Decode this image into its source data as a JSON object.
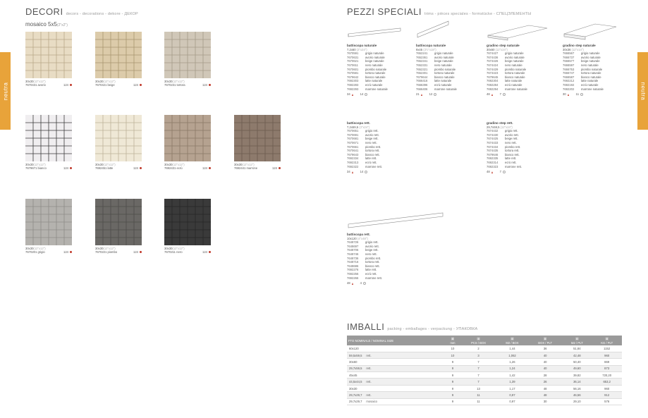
{
  "side_tab": {
    "left": "neutra",
    "right": "neutra"
  },
  "decori": {
    "title": "DECORI",
    "subtitle": "decors - decorations - dekore - ДЕКОР",
    "mosaico_title": "mosaico 5x5",
    "mosaico_dim": "(2\"x2\")",
    "tiles": [
      {
        "size": "30x30",
        "unit": "(12\"x12\")",
        "code": "7670431",
        "color": "avorio",
        "qty": "124",
        "bg": "#e8dcc4",
        "line": "#b8a888"
      },
      {
        "size": "30x30",
        "unit": "(12\"x12\")",
        "code": "7670421",
        "color": "beige",
        "qty": "124",
        "bg": "#dccbaa",
        "line": "#a8956f"
      },
      {
        "size": "30x30",
        "unit": "(12\"x12\")",
        "code": "7670231",
        "color": "tortora",
        "qty": "124",
        "bg": "#d0c7b8",
        "line": "#a49a88"
      },
      {
        "size": "30x30",
        "unit": "(12\"x12\")",
        "code": "7679671",
        "color": "bianco",
        "qty": "124",
        "bg": "#f0eef0",
        "line": "#3a3a3a"
      },
      {
        "size": "30x30",
        "unit": "(12\"x12\")",
        "code": "7692451",
        "color": "latte",
        "qty": "124",
        "bg": "#efe8d6",
        "line": "#bdb298"
      },
      {
        "size": "30x30",
        "unit": "(12\"x12\")",
        "code": "7692431",
        "color": "ecrù",
        "qty": "124",
        "bg": "#b5a290",
        "line": "#8a7866"
      },
      {
        "size": "30x30",
        "unit": "(12\"x12\")",
        "code": "7692441",
        "color": "marrone",
        "qty": "124",
        "bg": "#8d7a6c",
        "line": "#6b5a4e"
      },
      {
        "size": "30x30",
        "unit": "(12\"x12\")",
        "code": "7670201",
        "color": "grigio",
        "qty": "124",
        "bg": "#b4b2ae",
        "line": "#8e8c88"
      },
      {
        "size": "30x30",
        "unit": "(12\"x12\")",
        "code": "7670221",
        "color": "piombo",
        "qty": "124",
        "bg": "#6a6865",
        "line": "#4e4c4a"
      },
      {
        "size": "30x30",
        "unit": "(12\"x12\")",
        "code": "7670211",
        "color": "nero",
        "qty": "124",
        "bg": "#3a3a3a",
        "line": "#262626"
      }
    ]
  },
  "pezzi": {
    "title": "PEZZI SPECIALI",
    "subtitle": "trims - pièces speciales - formstücke - СПЕЦЭЛЕМЕНТЫ",
    "blocks": [
      {
        "name": "battiscopa naturale",
        "dim": "7,2x60",
        "unit": "(3\"x24\")",
        "rows": [
          [
            "7670591",
            "grigio naturale"
          ],
          [
            "7670631",
            "avorio naturale"
          ],
          [
            "7670621",
            "beige naturale"
          ],
          [
            "7670611",
            "nero naturale"
          ],
          [
            "7670601",
            "piombo naturale"
          ],
          [
            "7670581",
            "tortora naturale"
          ],
          [
            "7679642",
            "bianco naturale"
          ],
          [
            "7692303",
            "latte naturale"
          ],
          [
            "7692283",
            "ecrù naturale"
          ],
          [
            "7692293",
            "marrone naturale"
          ]
        ],
        "qty_a": "34",
        "qty_b": "14"
      },
      {
        "name": "battiscopa naturale",
        "dim": "9x45",
        "unit": "(3½\"x18\")",
        "rows": [
          [
            "7652241",
            "grigio naturale"
          ],
          [
            "7652361",
            "avorio naturale"
          ],
          [
            "7652341",
            "beige naturale"
          ],
          [
            "7652331",
            "nero naturale"
          ],
          [
            "7652321",
            "piombo naturale"
          ],
          [
            "7652301",
            "tortora naturale"
          ],
          [
            "7679644",
            "bianco naturale"
          ],
          [
            "7666416",
            "latte naturale"
          ],
          [
            "7666396",
            "ecrù naturale"
          ],
          [
            "7666406",
            "marrone naturale"
          ]
        ],
        "qty_a": "21",
        "qty_b": "12"
      },
      {
        "name": "gradino step naturale",
        "dim": "30x60",
        "unit": "(12\"x24\")",
        "rows": [
          [
            "7674427",
            "grigio naturale"
          ],
          [
            "7674436",
            "avorio naturale"
          ],
          [
            "7674426",
            "beige naturale"
          ],
          [
            "7674424",
            "nero naturale"
          ],
          [
            "7674429",
            "piombo naturale"
          ],
          [
            "7674423",
            "tortora naturale"
          ],
          [
            "7679645",
            "bianco naturale"
          ],
          [
            "7692304",
            "latte naturale"
          ],
          [
            "7692284",
            "ecrù naturale"
          ],
          [
            "7692294",
            "marrone naturale"
          ]
        ],
        "qty_a": "48",
        "qty_b": "7"
      },
      {
        "name": "gradino step naturale",
        "dim": "30x36",
        "unit": "(12\"x14\")",
        "rows": [
          [
            "7666567",
            "grigio naturale"
          ],
          [
            "7666737",
            "avorio naturale"
          ],
          [
            "7666577",
            "beige naturale"
          ],
          [
            "7666597",
            "nero naturale"
          ],
          [
            "7666753",
            "piombo naturale"
          ],
          [
            "7666747",
            "tortora naturale"
          ],
          [
            "7666587",
            "bianco naturale"
          ],
          [
            "7692212",
            "latte naturale"
          ],
          [
            "7692192",
            "ecrù naturale"
          ],
          [
            "7692202",
            "marrone naturale"
          ]
        ],
        "qty_a": "30",
        "qty_b": "11"
      },
      {
        "name": "battiscopa rett.",
        "dim": "7,2x59,5",
        "unit": "(3\"x24\")",
        "rows": [
          [
            "7670651",
            "grigio rett."
          ],
          [
            "7670691",
            "avorio rett."
          ],
          [
            "7670681",
            "beige rett."
          ],
          [
            "7670671",
            "nero rett."
          ],
          [
            "7670661",
            "piombo rett."
          ],
          [
            "7670641",
            "tortora rett."
          ],
          [
            "7679643",
            "bianco rett."
          ],
          [
            "7692334",
            "latte rett."
          ],
          [
            "7692313",
            "ecrù rett."
          ],
          [
            "7692322",
            "marrone rett."
          ]
        ],
        "qty_a": "34",
        "qty_b": "14"
      },
      {
        "name": "gradino step rett.",
        "dim": "29,7x59,5",
        "unit": "(12\"x24\")",
        "rows": [
          [
            "7674432",
            "grigio rett."
          ],
          [
            "7674430",
            "avorio rett."
          ],
          [
            "7674425",
            "beige rett."
          ],
          [
            "7674433",
            "nero rett."
          ],
          [
            "7674434",
            "piombo rett."
          ],
          [
            "7674435",
            "tortora rett."
          ],
          [
            "7679646",
            "bianco rett."
          ],
          [
            "7692335",
            "latte rett."
          ],
          [
            "7692314",
            "ecrù rett."
          ],
          [
            "7692323",
            "marrone rett."
          ]
        ],
        "qty_a": "48",
        "qty_b": "7"
      },
      {
        "name": "battiscopa rett.",
        "dim": "10x120",
        "unit": "(4\"x48\")",
        "rows": [
          [
            "7648726",
            "grigio rett."
          ],
          [
            "7648697",
            "avorio rett."
          ],
          [
            "7648706",
            "beige rett."
          ],
          [
            "7648746",
            "nero rett."
          ],
          [
            "7648736",
            "piombo rett."
          ],
          [
            "7648716",
            "tortora rett."
          ],
          [
            "7648686",
            "bianco rett."
          ],
          [
            "7692276",
            "latte rett."
          ],
          [
            "7692256",
            "ecrù rett."
          ],
          [
            "7692266",
            "marrone rett."
          ]
        ],
        "qty_a": "48",
        "qty_b": "4"
      }
    ]
  },
  "imballi": {
    "title": "IMBALLI",
    "subtitle": "packing - emballages - verpackung - УПАКОВКА",
    "headers": [
      "FTO NOMINALE / NOMINAL SIZE",
      "mm",
      "PCS / BOX",
      "M2 / BOX",
      "BOX / PLT",
      "M2 / PLT",
      "KG / PLT"
    ],
    "rows": [
      [
        "60x120",
        "",
        "10",
        "2",
        "1,44",
        "36",
        "51,84",
        "1152"
      ],
      [
        "59,5x59,5",
        "rett.",
        "10",
        "3",
        "1,062",
        "40",
        "42,48",
        "960"
      ],
      [
        "30x60",
        "",
        "9",
        "7",
        "1,26",
        "40",
        "50,40",
        "869"
      ],
      [
        "29,7x59,5",
        "rett.",
        "9",
        "7",
        "1,24",
        "40",
        "49,60",
        "873"
      ],
      [
        "45x45",
        "",
        "9",
        "7",
        "1,42",
        "28",
        "39,82",
        "720,20"
      ],
      [
        "44,5x44,5",
        "rett.",
        "9",
        "7",
        "1,39",
        "26",
        "36,14",
        "653,2"
      ],
      [
        "30x30",
        "",
        "9",
        "13",
        "1,17",
        "48",
        "56,16",
        "960"
      ],
      [
        "29,7x29,7",
        "rett.",
        "9",
        "11",
        "0,97",
        "48",
        "46,56",
        "912"
      ],
      [
        "29,7x29,7",
        "mosaico",
        "9",
        "11",
        "0,97",
        "30",
        "29,10",
        "576"
      ]
    ]
  }
}
